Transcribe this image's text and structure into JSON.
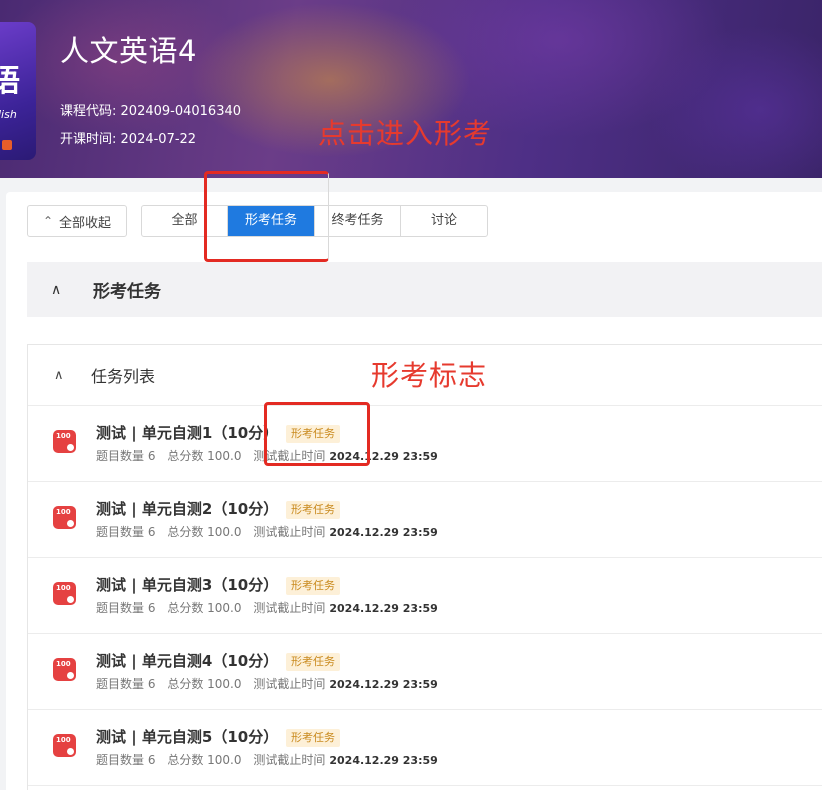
{
  "header": {
    "course_title": "人文英语4",
    "course_code_label": "课程代码:",
    "course_code": "202409-04016340",
    "start_label": "开课时间:",
    "start_date": "2024-07-22",
    "cover_text": "语",
    "cover_sub": "lish"
  },
  "annotations": {
    "enter_hint": "点击进入形考",
    "mark_hint": "形考标志"
  },
  "toolbar": {
    "collapse_all": "全部收起",
    "tabs": [
      {
        "label": "全部",
        "active": false
      },
      {
        "label": "形考任务",
        "active": true
      },
      {
        "label": "终考任务",
        "active": false
      },
      {
        "label": "讨论",
        "active": false
      }
    ]
  },
  "section": {
    "title": "形考任务"
  },
  "task_list": {
    "title": "任务列表",
    "icon_text": "100",
    "items": [
      {
        "title": "测试 | 单元自测1（10分）",
        "badge": "形考任务",
        "count_label": "题目数量",
        "count": "6",
        "score_label": "总分数",
        "score": "100.0",
        "deadline_label": "测试截止时间",
        "deadline": "2024.12.29 23:59"
      },
      {
        "title": "测试 | 单元自测2（10分）",
        "badge": "形考任务",
        "count_label": "题目数量",
        "count": "6",
        "score_label": "总分数",
        "score": "100.0",
        "deadline_label": "测试截止时间",
        "deadline": "2024.12.29 23:59"
      },
      {
        "title": "测试 | 单元自测3（10分）",
        "badge": "形考任务",
        "count_label": "题目数量",
        "count": "6",
        "score_label": "总分数",
        "score": "100.0",
        "deadline_label": "测试截止时间",
        "deadline": "2024.12.29 23:59"
      },
      {
        "title": "测试 | 单元自测4（10分）",
        "badge": "形考任务",
        "count_label": "题目数量",
        "count": "6",
        "score_label": "总分数",
        "score": "100.0",
        "deadline_label": "测试截止时间",
        "deadline": "2024.12.29 23:59"
      },
      {
        "title": "测试 | 单元自测5（10分）",
        "badge": "形考任务",
        "count_label": "题目数量",
        "count": "6",
        "score_label": "总分数",
        "score": "100.0",
        "deadline_label": "测试截止时间",
        "deadline": "2024.12.29 23:59"
      }
    ]
  },
  "colors": {
    "accent": "#1f7ae0",
    "annotation": "#e63a2e",
    "badge_bg": "#fdf0d8",
    "badge_text": "#c98a1e",
    "task_icon": "#e54141"
  }
}
